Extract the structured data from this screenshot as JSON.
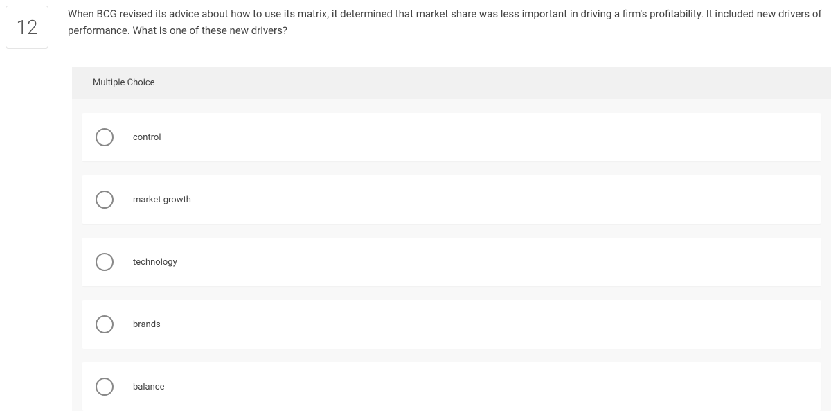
{
  "question": {
    "number": "12",
    "text": "When BCG revised its advice about how to use its matrix, it determined that market share was less important in driving a firm's profitability. It included new drivers of performance. What is one of these new drivers?",
    "type_label": "Multiple Choice",
    "options": [
      {
        "label": "control"
      },
      {
        "label": "market growth"
      },
      {
        "label": "technology"
      },
      {
        "label": "brands"
      },
      {
        "label": "balance"
      }
    ]
  }
}
